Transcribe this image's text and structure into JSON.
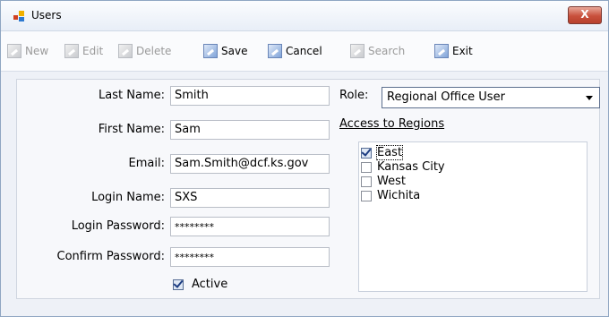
{
  "window": {
    "title": "Users",
    "close_label": "X"
  },
  "toolbar": {
    "buttons": [
      {
        "label": "New",
        "enabled": false
      },
      {
        "label": "Edit",
        "enabled": false
      },
      {
        "label": "Delete",
        "enabled": false
      },
      {
        "label": "Save",
        "enabled": true
      },
      {
        "label": "Cancel",
        "enabled": true
      },
      {
        "label": "Search",
        "enabled": false
      },
      {
        "label": "Exit",
        "enabled": true
      }
    ]
  },
  "form": {
    "last_name_label": "Last Name:",
    "last_name_value": "Smith",
    "first_name_label": "First Name:",
    "first_name_value": "Sam",
    "email_label": "Email:",
    "email_value": "Sam.Smith@dcf.ks.gov",
    "login_name_label": "Login Name:",
    "login_name_value": "SXS",
    "login_password_label": "Login Password:",
    "login_password_value": "********",
    "confirm_password_label": "Confirm Password:",
    "confirm_password_value": "********",
    "active_label": "Active",
    "active_checked": true,
    "role_label": "Role:",
    "role_value": "Regional Office User",
    "regions_heading": "Access to Regions",
    "regions": [
      {
        "label": "East",
        "checked": true
      },
      {
        "label": "Kansas City",
        "checked": false
      },
      {
        "label": "West",
        "checked": false
      },
      {
        "label": "Wichita",
        "checked": false
      }
    ]
  },
  "colors": {
    "close_button": "#c8503c",
    "accent_blue": "#1d3d82",
    "panel_bg": "#f7f8fb"
  }
}
